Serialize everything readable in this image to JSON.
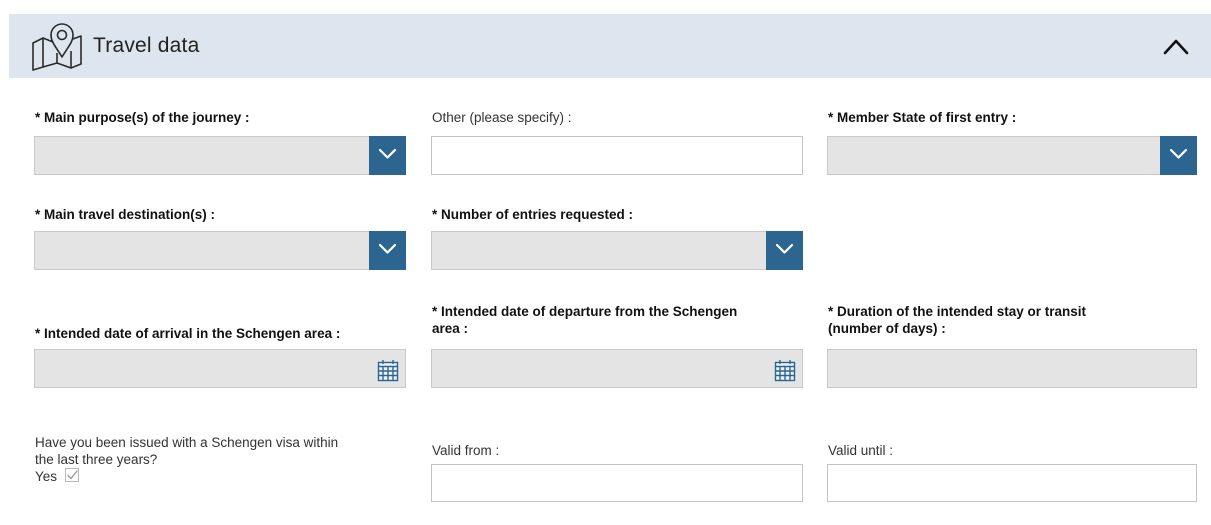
{
  "panel": {
    "title": "Travel data",
    "icon": "map-pin-icon",
    "collapse_icon": "chevron-up-icon",
    "accent_color": "#2d6591",
    "header_color": "#dde6ee"
  },
  "fields": {
    "main_purpose": {
      "label": "* Main purpose(s) of the journey :",
      "value": ""
    },
    "other_specify": {
      "label": "Other (please specify) :",
      "value": ""
    },
    "member_state": {
      "label": "* Member State of first entry :",
      "value": ""
    },
    "main_destination": {
      "label": "* Main travel destination(s) :",
      "value": ""
    },
    "entries_requested": {
      "label": "* Number of entries requested :",
      "value": ""
    },
    "arrival_date": {
      "label": "* Intended date of arrival in the Schengen area :",
      "value": ""
    },
    "departure_date": {
      "label_line1": "* Intended date of departure from the Schengen",
      "label_line2": "area :",
      "value": ""
    },
    "duration": {
      "label_line1": "* Duration of the intended stay or transit",
      "label_line2": "(number of days) :",
      "value": ""
    },
    "previous_visa": {
      "question_line1": "Have you been issued with a Schengen visa within",
      "question_line2": "the last three years?",
      "yes_label": "Yes"
    },
    "valid_from": {
      "label": "Valid from :",
      "value": ""
    },
    "valid_until": {
      "label": "Valid until :",
      "value": ""
    }
  }
}
